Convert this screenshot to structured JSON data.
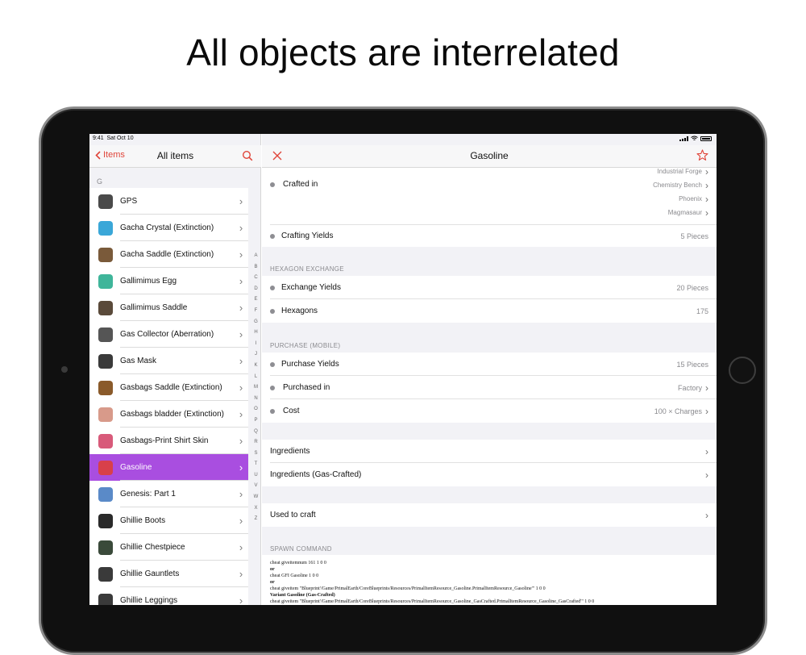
{
  "headline": "All objects are interrelated",
  "status": {
    "time": "9:41",
    "date": "Sat Oct 10"
  },
  "left": {
    "back_label": "Items",
    "title": "All items",
    "section": "G",
    "items": [
      {
        "label": "GPS",
        "color": "#4a4a4a"
      },
      {
        "label": "Gacha Crystal (Extinction)",
        "color": "#3aa7d8"
      },
      {
        "label": "Gacha Saddle (Extinction)",
        "color": "#7a5a3a"
      },
      {
        "label": "Gallimimus Egg",
        "color": "#3fb59a"
      },
      {
        "label": "Gallimimus Saddle",
        "color": "#5a4a3a"
      },
      {
        "label": "Gas Collector (Aberration)",
        "color": "#555555"
      },
      {
        "label": "Gas Mask",
        "color": "#3a3a3a"
      },
      {
        "label": "Gasbags Saddle (Extinction)",
        "color": "#8a5a2a"
      },
      {
        "label": "Gasbags bladder (Extinction)",
        "color": "#d89a8a"
      },
      {
        "label": "Gasbags-Print Shirt Skin",
        "color": "#d85a7a"
      },
      {
        "label": "Gasoline",
        "color": "#d8404a",
        "selected": true
      },
      {
        "label": "Genesis: Part 1",
        "color": "#5a8ac8"
      },
      {
        "label": "Ghillie Boots",
        "color": "#2a2a2a"
      },
      {
        "label": "Ghillie Chestpiece",
        "color": "#3a4a3a"
      },
      {
        "label": "Ghillie Gauntlets",
        "color": "#3a3a3a"
      },
      {
        "label": "Ghillie Leggings",
        "color": "#3a3a3a"
      }
    ],
    "index_letters": [
      "A",
      "B",
      "C",
      "D",
      "E",
      "F",
      "G",
      "H",
      "I",
      "J",
      "K",
      "L",
      "M",
      "N",
      "O",
      "P",
      "Q",
      "R",
      "S",
      "T",
      "U",
      "V",
      "W",
      "X",
      "Z"
    ]
  },
  "detail": {
    "title": "Gasoline",
    "accent": "#e0453a",
    "crafted_label": "Crafted in",
    "crafted_partial": "Industrial Forge",
    "crafted_in": [
      "Chemistry Bench",
      "Phoenix",
      "Magmasaur"
    ],
    "crafting_yields_label": "Crafting Yields",
    "crafting_yields_value": "5 Pieces",
    "hex_header": "HEXAGON EXCHANGE",
    "exchange_yields_label": "Exchange Yields",
    "exchange_yields_value": "20 Pieces",
    "hexagons_label": "Hexagons",
    "hexagons_value": "175",
    "purchase_header": "PURCHASE (MOBILE)",
    "purchase_yields_label": "Purchase Yields",
    "purchase_yields_value": "15 Pieces",
    "purchased_in_label": "Purchased in",
    "purchased_in_value": "Factory",
    "cost_label": "Cost",
    "cost_value": "100 × Charges",
    "ingredients_label": "Ingredients",
    "ingredients_gas_label": "Ingredients (Gas-Crafted)",
    "used_to_craft_label": "Used to craft",
    "spawn_header": "SPAWN COMMAND",
    "spawn_lines": [
      "cheat giveitemnum 161 1 0 0",
      "or",
      "cheat GFI Gasoline 1 0 0",
      "or",
      "cheat giveitem \"Blueprint'/Game/PrimalEarth/CoreBlueprints/Resources/PrimalItemResource_Gasoline.PrimalItemResource_Gasoline'\" 1 0 0",
      "Variant Gasoline (Gas-Crafted)",
      "cheat giveitem \"Blueprint'/Game/PrimalEarth/CoreBlueprints/Resources/PrimalItemResource_Gasoline_GasCrafted.PrimalItemResource_Gasoline_GasCrafted'\" 1 0 0"
    ]
  }
}
